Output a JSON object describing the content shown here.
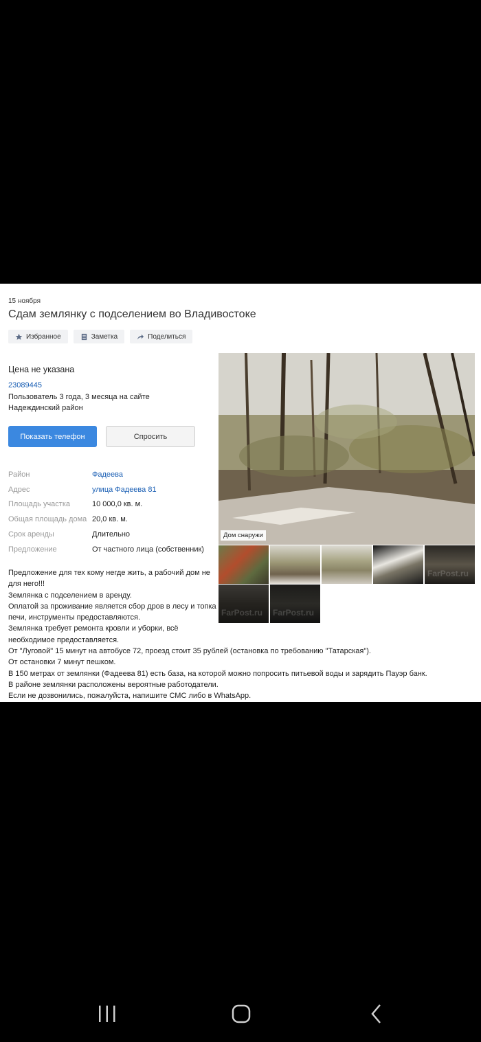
{
  "listing": {
    "date": "15 ноября",
    "title": "Сдам землянку с подселением во Владивостоке",
    "actions": {
      "favorite": "Избранное",
      "note": "Заметка",
      "share": "Поделиться"
    },
    "price": "Цена не указана",
    "seller": {
      "id": "23089445",
      "tenure": "Пользователь 3 года, 3 месяца на сайте",
      "district": "Надеждинский район"
    },
    "buttons": {
      "show_phone": "Показать телефон",
      "ask": "Спросить"
    },
    "params": [
      {
        "label": "Район",
        "value": "Фадеева"
      },
      {
        "label": "Адрес",
        "value": "улица Фадеева 81"
      },
      {
        "label": "Площадь участка",
        "value": "10 000,0 кв. м."
      },
      {
        "label": "Общая площадь дома",
        "value": "20,0 кв. м."
      },
      {
        "label": "Срок аренды",
        "value": "Длительно"
      },
      {
        "label": "Предложение",
        "value": "От частного лица (собственник)"
      }
    ],
    "description": [
      "Предложение для тех кому негде жить, а рабочий дом не",
      "для него!!!",
      "Землянка с подселением в аренду.",
      "Оплатой за проживание является сбор дров в лесу и топка",
      "печи, инструменты предоставляются.",
      "Землянка требует ремонта кровли и уборки, всё",
      "необходимое предоставляется.",
      "От \"Луговой\" 15 минут на автобусе 72, проезд стоит 35 рублей (остановка по требованию \"Татарская\").",
      "От остановки 7 минут пешком.",
      "В 150 метрах от землянки (Фадеева 81) есть база, на которой можно попросить питьевой воды и зарядить Пауэр банк.",
      "В районе землянки расположены вероятные работодатели.",
      "Если не дозвонились, пожалуйста, напишите СМС либо в WhatsApp."
    ],
    "photo": {
      "caption": "Дом снаружи"
    },
    "thumbnails": [
      {
        "name": "thumb-1",
        "watermark": ""
      },
      {
        "name": "thumb-2",
        "watermark": ""
      },
      {
        "name": "thumb-3",
        "watermark": ""
      },
      {
        "name": "thumb-4",
        "watermark": ""
      },
      {
        "name": "thumb-5",
        "watermark": "FarPost.ru"
      },
      {
        "name": "thumb-6",
        "watermark": "FarPost.ru"
      },
      {
        "name": "thumb-7",
        "watermark": "FarPost.ru"
      }
    ]
  },
  "icons": {
    "favorite": "star-icon",
    "note": "note-icon",
    "share": "share-arrow-icon",
    "nav_recents": "recents-icon",
    "nav_home": "home-icon",
    "nav_back": "back-icon"
  },
  "colors": {
    "link": "#1a5fb4",
    "primary_button": "#3b88e0",
    "label_gray": "#999999"
  }
}
